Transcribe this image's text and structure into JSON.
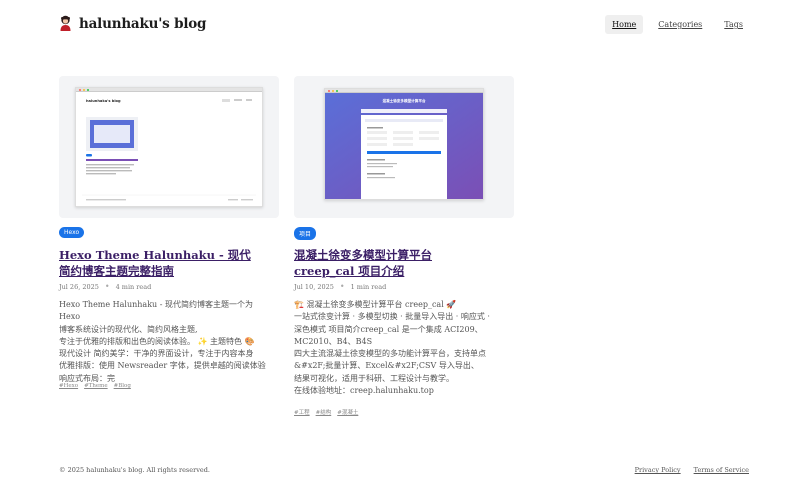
{
  "header": {
    "site_title": "halunhaku's blog",
    "nav": [
      {
        "label": "Home",
        "active": true
      },
      {
        "label": "Categories",
        "active": false
      },
      {
        "label": "Tags",
        "active": false
      }
    ]
  },
  "posts": [
    {
      "badge": "Hexo",
      "title": "Hexo Theme Halunhaku - 现代简约博客主题完整指南",
      "date": "Jul 26, 2025",
      "read_time": "4 min read",
      "excerpt": "Hexo Theme Halunhaku - 现代简约博客主题一个为 Hexo\n博客系统设计的现代化、简约风格主题,\n专注于优雅的排版和出色的阅读体验。 ✨ 主题特色 🎨\n现代设计 简约美学：干净的界面设计，专注于内容本身\n优雅排版：使用 Newsreader 字体，提供卓越的阅读体验\n响应式布局：完",
      "tags": [
        "#Hexo",
        "#Theme",
        "#Blog"
      ],
      "thumb_caption": "halunhaku's blog"
    },
    {
      "badge": "项目",
      "title": "混凝土徐变多模型计算平台 creep_cal 项目介绍",
      "date": "Jul 10, 2025",
      "read_time": "1 min read",
      "excerpt": "🏗️ 混凝土徐变多模型计算平台 creep_cal 🚀\n一站式徐变计算 · 多模型切换 · 批量导入导出 · 响应式 ·\n深色模式 项目简介creep_cal 是一个集成 ACI209、\nMC2010、B4、B4S\n四大主流混凝土徐变模型的多功能计算平台，支持单点\n&#x2F;批量计算、Excel&#x2F;CSV 导入导出、\n结果可视化，适用于科研、工程设计与教学。\n在线体验地址：creep.halunhaku.top",
      "tags": [
        "#工程",
        "#结构",
        "#混凝土"
      ],
      "thumb_caption": "混凝土徐变多模型计算平台"
    }
  ],
  "footer": {
    "copyright": "© 2025 halunhaku's blog. All rights reserved.",
    "links": [
      "Privacy Policy",
      "Terms of Service"
    ]
  },
  "colors": {
    "badge": "#1a73e8",
    "title_link": "#3b1f66",
    "thumb_bg": "#f3f4f6",
    "gradient_start": "#5a6fd8",
    "gradient_end": "#7b4fb5"
  }
}
